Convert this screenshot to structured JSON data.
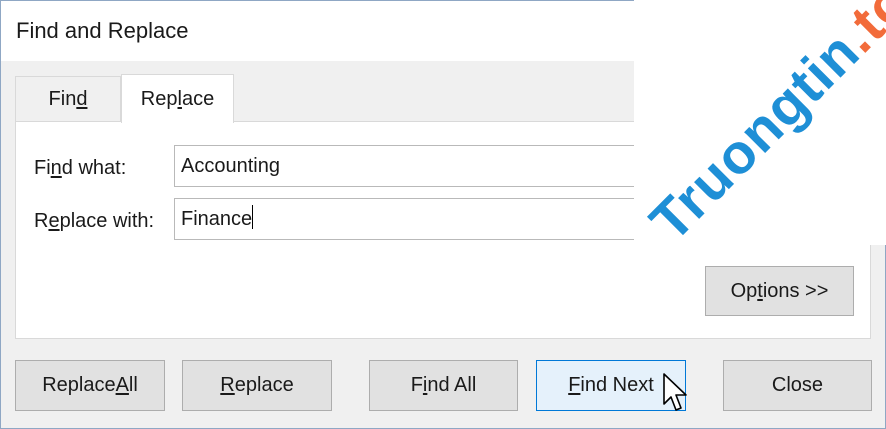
{
  "window": {
    "title": "Find and Replace"
  },
  "tabs": [
    {
      "label_pre": "Fin",
      "label_ul": "d",
      "label_post": "",
      "active": false
    },
    {
      "label_pre": "Rep",
      "label_ul": "l",
      "label_post": "ace",
      "active": true
    }
  ],
  "fields": {
    "find": {
      "label_pre": "Fi",
      "label_ul": "n",
      "label_post": "d what:",
      "value": "Accounting"
    },
    "replace": {
      "label_pre": "R",
      "label_ul": "e",
      "label_post": "place with:",
      "value": "Finance"
    }
  },
  "buttons": {
    "options": {
      "pre": "Op",
      "ul": "t",
      "post": "ions >>"
    },
    "replace_all": {
      "pre": "Replace ",
      "ul": "A",
      "post": "ll"
    },
    "replace": {
      "pre": "",
      "ul": "R",
      "post": "eplace"
    },
    "find_all": {
      "pre": "F",
      "ul": "i",
      "post": "nd All"
    },
    "find_next": {
      "pre": "",
      "ul": "F",
      "post": "ind Next"
    },
    "close": {
      "pre": "Close",
      "ul": "",
      "post": ""
    }
  },
  "watermark": {
    "text": "Truongtin",
    "dot": ".",
    "suffix": "top"
  },
  "colors": {
    "accent": "#0078d7",
    "watermark_blue": "#1e8fd6",
    "watermark_orange": "#f26b3a"
  }
}
